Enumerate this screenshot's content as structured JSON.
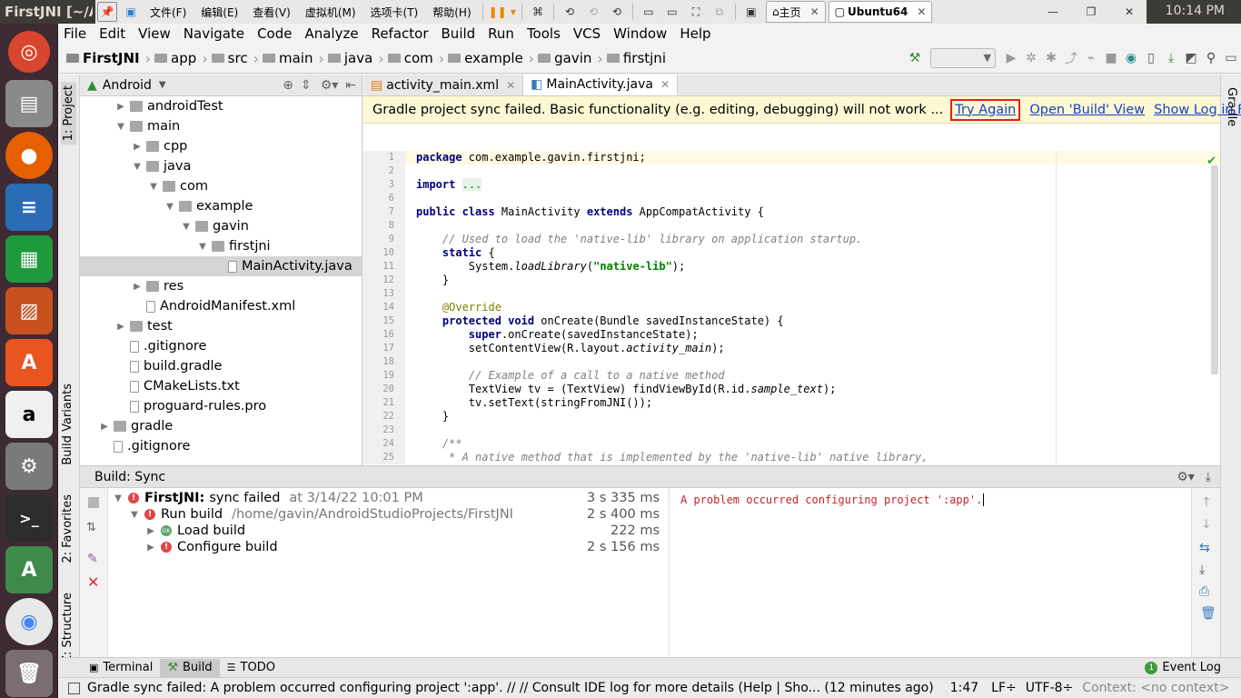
{
  "window_title": "FirstJNI [~/An",
  "clock": "10:14 PM",
  "vm_toolbar": {
    "menus": [
      "文件(F)",
      "编辑(E)",
      "查看(V)",
      "虚拟机(M)",
      "选项卡(T)",
      "帮助(H)"
    ],
    "tabs": [
      {
        "label": "主页"
      },
      {
        "label": "Ubuntu64"
      }
    ]
  },
  "launcher": {
    "apps": [
      "ubuntu-dash",
      "files",
      "firefox",
      "libreoffice-writer",
      "libreoffice-calc",
      "libreoffice-impress",
      "ubuntu-software",
      "amazon",
      "system-settings",
      "terminal",
      "android-studio",
      "chrome",
      "trash"
    ]
  },
  "menubar": [
    "File",
    "Edit",
    "View",
    "Navigate",
    "Code",
    "Analyze",
    "Refactor",
    "Build",
    "Run",
    "Tools",
    "VCS",
    "Window",
    "Help"
  ],
  "breadcrumb": [
    "FirstJNI",
    "app",
    "src",
    "main",
    "java",
    "com",
    "example",
    "gavin",
    "firstjni"
  ],
  "left_strip": {
    "project": "1: Project",
    "build_variants": "Build Variants",
    "favorites": "2: Favorites",
    "structure": "Z: Structure"
  },
  "right_strip": {
    "gradle": "Gradle"
  },
  "project_panel": {
    "view_mode": "Android",
    "tree": [
      {
        "label": "androidTest",
        "depth": 1,
        "arrow": "▶",
        "type": "folder"
      },
      {
        "label": "main",
        "depth": 1,
        "arrow": "▼",
        "type": "folder"
      },
      {
        "label": "cpp",
        "depth": 2,
        "arrow": "▶",
        "type": "folder"
      },
      {
        "label": "java",
        "depth": 2,
        "arrow": "▼",
        "type": "folder"
      },
      {
        "label": "com",
        "depth": 3,
        "arrow": "▼",
        "type": "folder"
      },
      {
        "label": "example",
        "depth": 4,
        "arrow": "▼",
        "type": "folder"
      },
      {
        "label": "gavin",
        "depth": 5,
        "arrow": "▼",
        "type": "folder"
      },
      {
        "label": "firstjni",
        "depth": 6,
        "arrow": "▼",
        "type": "folder"
      },
      {
        "label": "MainActivity.java",
        "depth": 7,
        "arrow": "",
        "type": "file",
        "selected": true
      },
      {
        "label": "res",
        "depth": 2,
        "arrow": "▶",
        "type": "folder"
      },
      {
        "label": "AndroidManifest.xml",
        "depth": 2,
        "arrow": "",
        "type": "file"
      },
      {
        "label": "test",
        "depth": 1,
        "arrow": "▶",
        "type": "folder"
      },
      {
        "label": ".gitignore",
        "depth": 1,
        "arrow": "",
        "type": "file"
      },
      {
        "label": "build.gradle",
        "depth": 1,
        "arrow": "",
        "type": "file"
      },
      {
        "label": "CMakeLists.txt",
        "depth": 1,
        "arrow": "",
        "type": "file"
      },
      {
        "label": "proguard-rules.pro",
        "depth": 1,
        "arrow": "",
        "type": "file"
      },
      {
        "label": "gradle",
        "depth": 0,
        "arrow": "▶",
        "type": "folder"
      },
      {
        "label": ".gitignore",
        "depth": 0,
        "arrow": "",
        "type": "file"
      }
    ]
  },
  "editor": {
    "tabs": [
      {
        "label": "activity_main.xml"
      },
      {
        "label": "MainActivity.java"
      }
    ],
    "banner": {
      "message": "Gradle project sync failed. Basic functionality (e.g. editing, debugging) will not work ...",
      "try_again": "Try Again",
      "open_build": "Open 'Build' View",
      "show_log": "Show Log in Files"
    },
    "lines": [
      {
        "n": "1",
        "html": "<span class=\"kw\">package</span> com.example.gavin.firstjni;"
      },
      {
        "n": "2",
        "html": ""
      },
      {
        "n": "3",
        "html": "<span class=\"kw\">import</span> <span class=\"st\" style=\"font-weight:normal;background:#e8f2e8\">...</span>"
      },
      {
        "n": "6",
        "html": ""
      },
      {
        "n": "7",
        "html": "<span class=\"kw\">public class</span> MainActivity <span class=\"kw\">extends</span> AppCompatActivity {"
      },
      {
        "n": "8",
        "html": ""
      },
      {
        "n": "9",
        "html": "    <span class=\"cm\">// Used to load the 'native-lib' library on application startup.</span>"
      },
      {
        "n": "10",
        "html": "    <span class=\"kw\">static</span> {"
      },
      {
        "n": "11",
        "html": "        System.<i>loadLibrary</i>(<span class=\"st\">\"native-lib\"</span>);"
      },
      {
        "n": "12",
        "html": "    }"
      },
      {
        "n": "13",
        "html": ""
      },
      {
        "n": "14",
        "html": "    <span class=\"an\">@Override</span>"
      },
      {
        "n": "15",
        "html": "    <span class=\"kw\">protected void</span> onCreate(Bundle savedInstanceState) {"
      },
      {
        "n": "16",
        "html": "        <span class=\"kw\">super</span>.onCreate(savedInstanceState);"
      },
      {
        "n": "17",
        "html": "        setContentView(R.layout.<i>activity_main</i>);"
      },
      {
        "n": "18",
        "html": ""
      },
      {
        "n": "19",
        "html": "        <span class=\"cm\">// Example of a call to a native method</span>"
      },
      {
        "n": "20",
        "html": "        TextView tv = (TextView) findViewById(R.id.<i>sample_text</i>);"
      },
      {
        "n": "21",
        "html": "        tv.setText(stringFromJNI());"
      },
      {
        "n": "22",
        "html": "    }"
      },
      {
        "n": "23",
        "html": ""
      },
      {
        "n": "24",
        "html": "    <span class=\"cm\">/**</span>"
      },
      {
        "n": "25",
        "html": "     <span class=\"cm\">* A native method that is implemented by the 'native-lib' native library,</span>"
      }
    ]
  },
  "build": {
    "header": "Build: Sync",
    "rows": [
      {
        "icon": "error",
        "arrow": "▼",
        "depth": 0,
        "bold": "FirstJNI:",
        "label": "sync failed",
        "extra": "at 3/14/22 10:01 PM",
        "time": "3 s 335 ms"
      },
      {
        "icon": "error",
        "arrow": "▼",
        "depth": 1,
        "bold": "",
        "label": "Run build",
        "extra": "/home/gavin/AndroidStudioProjects/FirstJNI",
        "time": "2 s 400 ms"
      },
      {
        "icon": "ok",
        "arrow": "▶",
        "depth": 2,
        "bold": "",
        "label": "Load build",
        "extra": "",
        "time": "222 ms"
      },
      {
        "icon": "error",
        "arrow": "▶",
        "depth": 2,
        "bold": "",
        "label": "Configure build",
        "extra": "",
        "time": "2 s 156 ms"
      }
    ],
    "output": "A problem occurred configuring project ':app'."
  },
  "bottom_tabs": {
    "terminal": "Terminal",
    "build": "Build",
    "todo": "TODO",
    "event_log": "Event Log",
    "event_count": "1"
  },
  "status": {
    "message": "Gradle sync failed: A problem occurred configuring project ':app'. // // Consult IDE log for more details (Help | Sho... (12 minutes ago)",
    "position": "1:47",
    "line_sep": "LF÷",
    "encoding": "UTF-8÷",
    "context": "Context: <no context>"
  }
}
